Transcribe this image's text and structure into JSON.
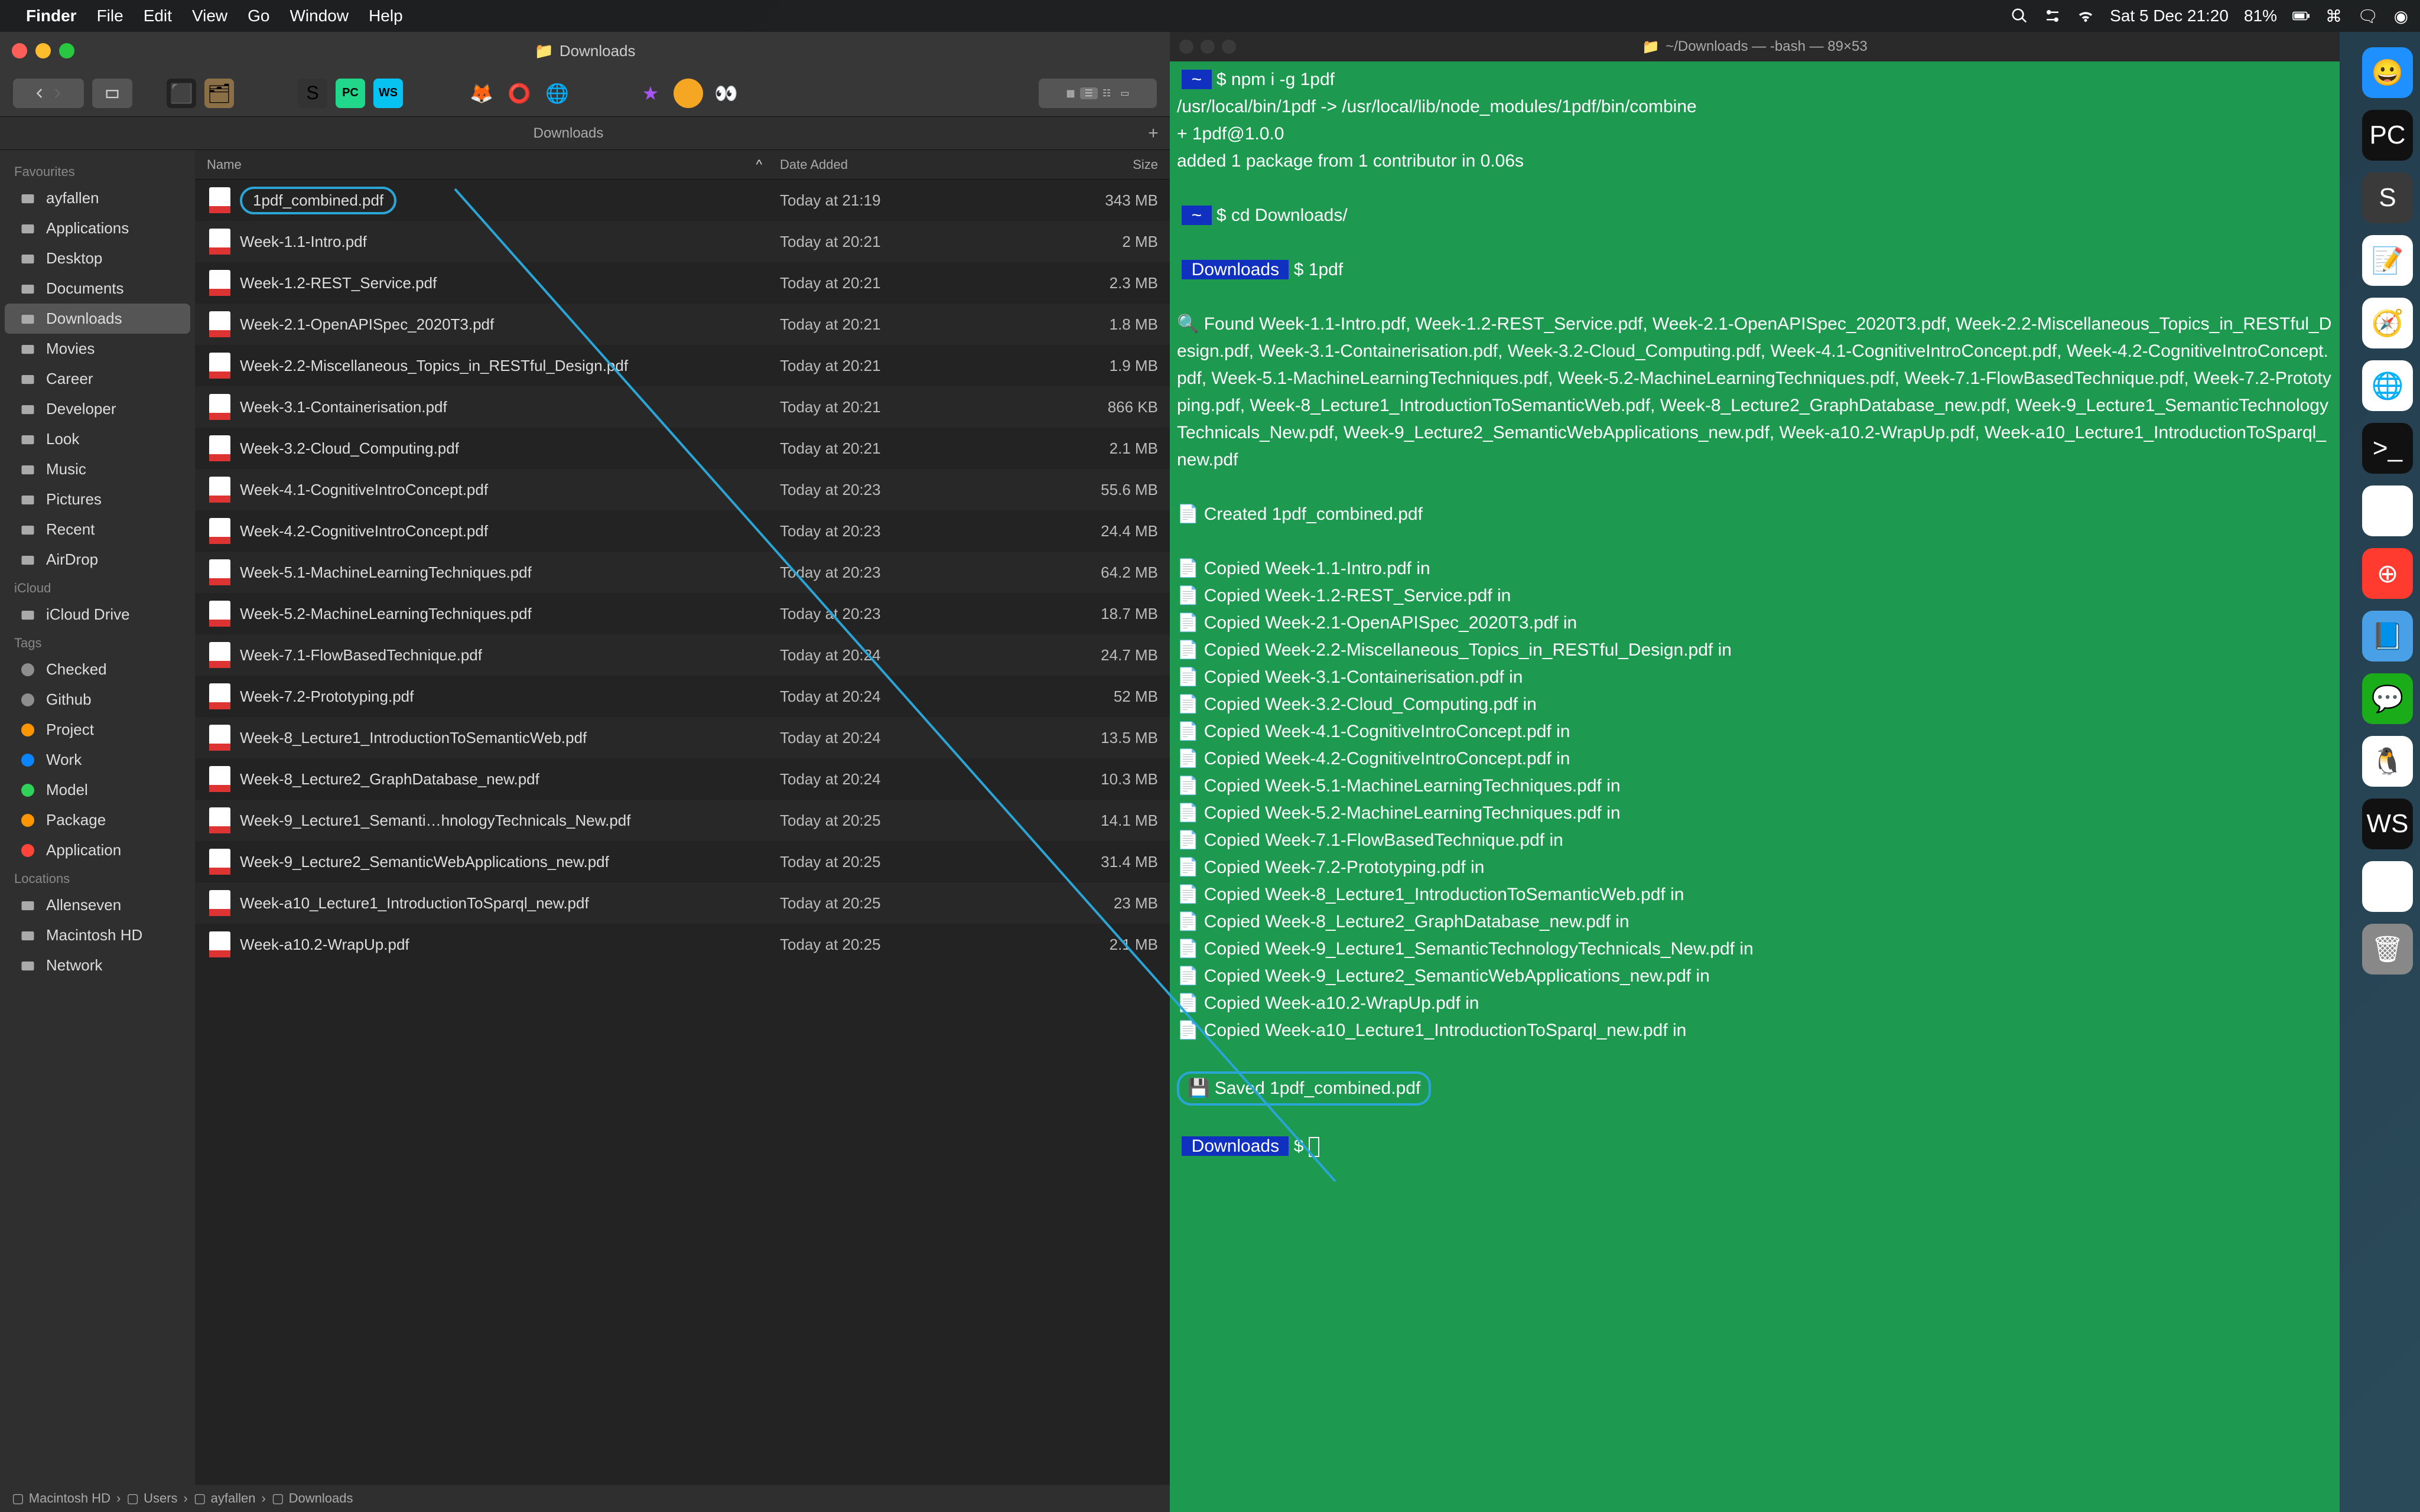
{
  "menubar": {
    "app": "Finder",
    "items": [
      "File",
      "Edit",
      "View",
      "Go",
      "Window",
      "Help"
    ],
    "clock": "Sat 5 Dec  21:20",
    "battery": "81%"
  },
  "finder": {
    "title": "Downloads",
    "tab": "Downloads",
    "columns": {
      "name": "Name",
      "date": "Date Added",
      "size": "Size"
    },
    "sidebar": {
      "favourites_label": "Favourites",
      "favourites": [
        {
          "label": "ayfallen",
          "icon": "home"
        },
        {
          "label": "Applications",
          "icon": "app"
        },
        {
          "label": "Desktop",
          "icon": "desktop"
        },
        {
          "label": "Documents",
          "icon": "doc"
        },
        {
          "label": "Downloads",
          "icon": "download",
          "selected": true
        },
        {
          "label": "Movies",
          "icon": "movie"
        },
        {
          "label": "Career",
          "icon": "folder"
        },
        {
          "label": "Developer",
          "icon": "folder"
        },
        {
          "label": "Look",
          "icon": "folder"
        },
        {
          "label": "Music",
          "icon": "music"
        },
        {
          "label": "Pictures",
          "icon": "picture"
        },
        {
          "label": "Recent",
          "icon": "clock"
        },
        {
          "label": "AirDrop",
          "icon": "airdrop"
        }
      ],
      "icloud_label": "iCloud",
      "icloud": [
        {
          "label": "iCloud Drive",
          "icon": "cloud"
        }
      ],
      "tags_label": "Tags",
      "tags": [
        {
          "label": "Checked",
          "color": "#8e8e8e"
        },
        {
          "label": "Github",
          "color": "#8e8e8e"
        },
        {
          "label": "Project",
          "color": "#ff9500"
        },
        {
          "label": "Work",
          "color": "#0a84ff"
        },
        {
          "label": "Model",
          "color": "#30d158"
        },
        {
          "label": "Package",
          "color": "#ff9500"
        },
        {
          "label": "Application",
          "color": "#ff453a"
        }
      ],
      "locations_label": "Locations",
      "locations": [
        {
          "label": "Allenseven",
          "icon": "disk"
        },
        {
          "label": "Macintosh HD",
          "icon": "disk"
        },
        {
          "label": "Network",
          "icon": "globe"
        }
      ]
    },
    "files": [
      {
        "name": "1pdf_combined.pdf",
        "date": "Today at 21:19",
        "size": "343 MB",
        "circled": true
      },
      {
        "name": "Week-1.1-Intro.pdf",
        "date": "Today at 20:21",
        "size": "2 MB"
      },
      {
        "name": "Week-1.2-REST_Service.pdf",
        "date": "Today at 20:21",
        "size": "2.3 MB"
      },
      {
        "name": "Week-2.1-OpenAPISpec_2020T3.pdf",
        "date": "Today at 20:21",
        "size": "1.8 MB"
      },
      {
        "name": "Week-2.2-Miscellaneous_Topics_in_RESTful_Design.pdf",
        "date": "Today at 20:21",
        "size": "1.9 MB"
      },
      {
        "name": "Week-3.1-Containerisation.pdf",
        "date": "Today at 20:21",
        "size": "866 KB"
      },
      {
        "name": "Week-3.2-Cloud_Computing.pdf",
        "date": "Today at 20:21",
        "size": "2.1 MB"
      },
      {
        "name": "Week-4.1-CognitiveIntroConcept.pdf",
        "date": "Today at 20:23",
        "size": "55.6 MB"
      },
      {
        "name": "Week-4.2-CognitiveIntroConcept.pdf",
        "date": "Today at 20:23",
        "size": "24.4 MB"
      },
      {
        "name": "Week-5.1-MachineLearningTechniques.pdf",
        "date": "Today at 20:23",
        "size": "64.2 MB"
      },
      {
        "name": "Week-5.2-MachineLearningTechniques.pdf",
        "date": "Today at 20:23",
        "size": "18.7 MB"
      },
      {
        "name": "Week-7.1-FlowBasedTechnique.pdf",
        "date": "Today at 20:24",
        "size": "24.7 MB"
      },
      {
        "name": "Week-7.2-Prototyping.pdf",
        "date": "Today at 20:24",
        "size": "52 MB"
      },
      {
        "name": "Week-8_Lecture1_IntroductionToSemanticWeb.pdf",
        "date": "Today at 20:24",
        "size": "13.5 MB"
      },
      {
        "name": "Week-8_Lecture2_GraphDatabase_new.pdf",
        "date": "Today at 20:24",
        "size": "10.3 MB"
      },
      {
        "name": "Week-9_Lecture1_Semanti…hnologyTechnicals_New.pdf",
        "date": "Today at 20:25",
        "size": "14.1 MB"
      },
      {
        "name": "Week-9_Lecture2_SemanticWebApplications_new.pdf",
        "date": "Today at 20:25",
        "size": "31.4 MB"
      },
      {
        "name": "Week-a10_Lecture1_IntroductionToSparql_new.pdf",
        "date": "Today at 20:25",
        "size": "23 MB"
      },
      {
        "name": "Week-a10.2-WrapUp.pdf",
        "date": "Today at 20:25",
        "size": "2.1 MB"
      }
    ],
    "path": [
      "Macintosh HD",
      "Users",
      "ayfallen",
      "Downloads"
    ]
  },
  "terminal": {
    "title": "~/Downloads — -bash — 89×53",
    "lines": [
      {
        "type": "prompt",
        "badge": "~",
        "text": "$ npm i -g 1pdf"
      },
      {
        "type": "out",
        "text": "/usr/local/bin/1pdf -> /usr/local/lib/node_modules/1pdf/bin/combine"
      },
      {
        "type": "out",
        "text": "+ 1pdf@1.0.0"
      },
      {
        "type": "out",
        "text": "added 1 package from 1 contributor in 0.06s"
      },
      {
        "type": "blank"
      },
      {
        "type": "prompt",
        "badge": "~",
        "text": "$ cd Downloads/"
      },
      {
        "type": "blank"
      },
      {
        "type": "prompt",
        "badge": "Downloads",
        "text": "$ 1pdf"
      },
      {
        "type": "blank"
      },
      {
        "type": "out",
        "icon": "🔍",
        "text": "Found Week-1.1-Intro.pdf, Week-1.2-REST_Service.pdf, Week-2.1-OpenAPISpec_2020T3.pdf, Week-2.2-Miscellaneous_Topics_in_RESTful_Design.pdf, Week-3.1-Containerisation.pdf, Week-3.2-Cloud_Computing.pdf, Week-4.1-CognitiveIntroConcept.pdf, Week-4.2-CognitiveIntroConcept.pdf, Week-5.1-MachineLearningTechniques.pdf, Week-5.2-MachineLearningTechniques.pdf, Week-7.1-FlowBasedTechnique.pdf, Week-7.2-Prototyping.pdf, Week-8_Lecture1_IntroductionToSemanticWeb.pdf, Week-8_Lecture2_GraphDatabase_new.pdf, Week-9_Lecture1_SemanticTechnologyTechnicals_New.pdf, Week-9_Lecture2_SemanticWebApplications_new.pdf, Week-a10.2-WrapUp.pdf, Week-a10_Lecture1_IntroductionToSparql_new.pdf"
      },
      {
        "type": "blank"
      },
      {
        "type": "out",
        "icon": "📄",
        "text": "Created 1pdf_combined.pdf"
      },
      {
        "type": "blank"
      },
      {
        "type": "out",
        "icon": "📄",
        "text": "Copied Week-1.1-Intro.pdf in"
      },
      {
        "type": "out",
        "icon": "📄",
        "text": "Copied Week-1.2-REST_Service.pdf in"
      },
      {
        "type": "out",
        "icon": "📄",
        "text": "Copied Week-2.1-OpenAPISpec_2020T3.pdf in"
      },
      {
        "type": "out",
        "icon": "📄",
        "text": "Copied Week-2.2-Miscellaneous_Topics_in_RESTful_Design.pdf in"
      },
      {
        "type": "out",
        "icon": "📄",
        "text": "Copied Week-3.1-Containerisation.pdf in"
      },
      {
        "type": "out",
        "icon": "📄",
        "text": "Copied Week-3.2-Cloud_Computing.pdf in"
      },
      {
        "type": "out",
        "icon": "📄",
        "text": "Copied Week-4.1-CognitiveIntroConcept.pdf in"
      },
      {
        "type": "out",
        "icon": "📄",
        "text": "Copied Week-4.2-CognitiveIntroConcept.pdf in"
      },
      {
        "type": "out",
        "icon": "📄",
        "text": "Copied Week-5.1-MachineLearningTechniques.pdf in"
      },
      {
        "type": "out",
        "icon": "📄",
        "text": "Copied Week-5.2-MachineLearningTechniques.pdf in"
      },
      {
        "type": "out",
        "icon": "📄",
        "text": "Copied Week-7.1-FlowBasedTechnique.pdf in"
      },
      {
        "type": "out",
        "icon": "📄",
        "text": "Copied Week-7.2-Prototyping.pdf in"
      },
      {
        "type": "out",
        "icon": "📄",
        "text": "Copied Week-8_Lecture1_IntroductionToSemanticWeb.pdf in"
      },
      {
        "type": "out",
        "icon": "📄",
        "text": "Copied Week-8_Lecture2_GraphDatabase_new.pdf in"
      },
      {
        "type": "out",
        "icon": "📄",
        "text": "Copied Week-9_Lecture1_SemanticTechnologyTechnicals_New.pdf in"
      },
      {
        "type": "out",
        "icon": "📄",
        "text": "Copied Week-9_Lecture2_SemanticWebApplications_new.pdf in"
      },
      {
        "type": "out",
        "icon": "📄",
        "text": "Copied Week-a10.2-WrapUp.pdf in"
      },
      {
        "type": "out",
        "icon": "📄",
        "text": "Copied Week-a10_Lecture1_IntroductionToSparql_new.pdf in"
      },
      {
        "type": "blank"
      },
      {
        "type": "out",
        "icon": "💾",
        "text": "Saved 1pdf_combined.pdf",
        "circled": true
      },
      {
        "type": "blank"
      },
      {
        "type": "prompt",
        "badge": "Downloads",
        "text": "$ ",
        "cursor": true
      }
    ]
  },
  "dock": [
    {
      "name": "finder",
      "color": "#1e90ff",
      "glyph": "😀"
    },
    {
      "name": "pycharm",
      "color": "#111",
      "glyph": "PC"
    },
    {
      "name": "sublime",
      "color": "#3a3a3a",
      "glyph": "S"
    },
    {
      "name": "notes",
      "color": "#fff",
      "glyph": "📝"
    },
    {
      "name": "safari",
      "color": "#fff",
      "glyph": "🧭"
    },
    {
      "name": "chrome",
      "color": "#fff",
      "glyph": "🌐"
    },
    {
      "name": "terminal",
      "color": "#111",
      "glyph": ">_"
    },
    {
      "name": "itunes",
      "color": "#fff",
      "glyph": "▶"
    },
    {
      "name": "app1",
      "color": "#ff3b30",
      "glyph": "⊕"
    },
    {
      "name": "dictionary",
      "color": "#4aa0e6",
      "glyph": "📘"
    },
    {
      "name": "wechat",
      "color": "#1aad19",
      "glyph": "💬"
    },
    {
      "name": "qq",
      "color": "#fff",
      "glyph": "🐧"
    },
    {
      "name": "webstorm",
      "color": "#111",
      "glyph": "WS"
    },
    {
      "name": "preview",
      "color": "#fff",
      "glyph": "🖼"
    },
    {
      "name": "trash",
      "color": "#888",
      "glyph": "🗑"
    }
  ]
}
